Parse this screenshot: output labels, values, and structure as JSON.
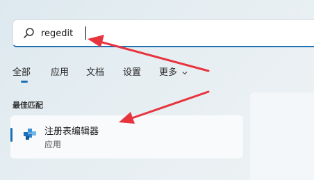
{
  "search": {
    "query": "regedit",
    "icon": "search-icon"
  },
  "tabs": [
    {
      "label": "全部",
      "selected": true
    },
    {
      "label": "应用"
    },
    {
      "label": "文档"
    },
    {
      "label": "设置"
    },
    {
      "label": "更多"
    }
  ],
  "best_match": {
    "title": "最佳匹配",
    "app_name": "注册表编辑器",
    "app_type": "应用",
    "icon": "registry-editor-icon"
  },
  "colors": {
    "accent": "#1f6fb5",
    "annotation_arrow": "#e8343f"
  }
}
